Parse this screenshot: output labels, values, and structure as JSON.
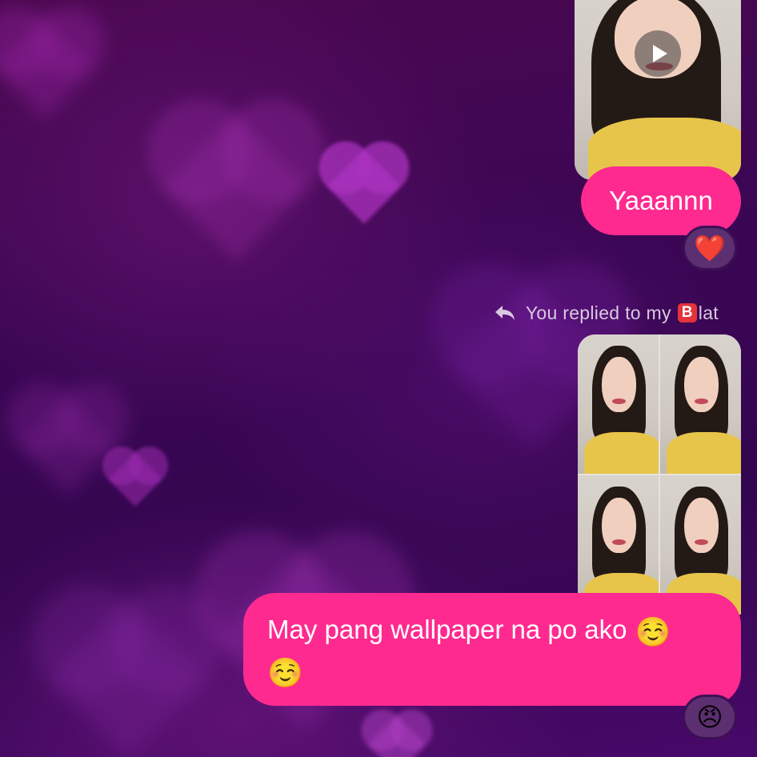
{
  "thread": {
    "video_message": {
      "media_type": "video",
      "play_icon": "play-icon"
    },
    "message_1": {
      "text": "Yaaannn",
      "reaction": "❤️"
    },
    "reply_context": {
      "icon": "reply-arrow-icon",
      "prefix": "You replied to my",
      "badge_letter": "B",
      "suffix": "lat"
    },
    "photo_message": {
      "media_type": "photo-collage"
    },
    "message_2": {
      "text": "May pang wallpaper na po ako",
      "emoji_1": "☺️",
      "emoji_2": "☺️",
      "reaction": "😠"
    }
  },
  "colors": {
    "bubble": "#fe2a8f",
    "background": "#3a0654",
    "reaction_pill": "#5c2f70"
  }
}
